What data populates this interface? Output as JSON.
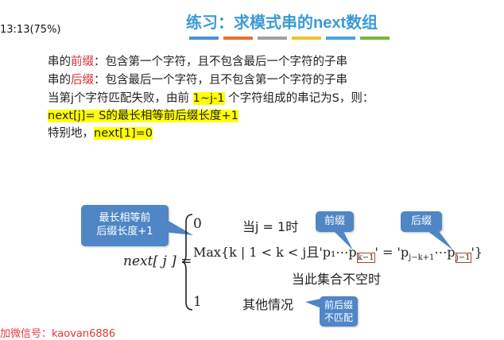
{
  "timestamp": "13:13(75%)",
  "title": {
    "prefix": "练习：求模式串的",
    "code": "next",
    "suffix": "数组"
  },
  "title_bar_colors": [
    "#4a90d9",
    "#e8702a",
    "#a0a0a0",
    "#f2c230",
    "#4aa3df",
    "#7cb342"
  ],
  "text": {
    "prefix_line": {
      "a": "串的",
      "b": "前缀",
      "c": "：包含第一个字符，且不包含最后一个字符的子串"
    },
    "suffix_line": {
      "a": "串的",
      "b": "后缀",
      "c": "：包含最后一个字符，且不包含第一个字符的子串"
    },
    "fail_line": {
      "a": "当第j个字符匹配失败，由前 ",
      "b": "1~j-1",
      "c": " 个字符组成的串记为S，则："
    },
    "def_line": "next[j]= S的最长相等前后缀长度+1",
    "special_line": {
      "a": "特别地，",
      "b": "next[1]=0"
    }
  },
  "callouts": {
    "longest": "最长相等前后缀长度+1",
    "prefix": "前缀",
    "suffix": "后缀",
    "no_match": "前后缀不匹配"
  },
  "formula": {
    "lhs": "next[ j ] =",
    "case1_value": "0",
    "case1_cond": "当j = 1时",
    "case2_text": "Max{k | 1 < k < j且'p₁⋯p",
    "case2_sub1": "k−1",
    "case2_mid": "' = 'p",
    "case2_sub2": "j−k+1",
    "case2_mid2": "⋯p",
    "case2_sub3": "j−1",
    "case2_end": "'}",
    "case2_note": "当此集合不空时",
    "case3_value": "1",
    "case3_cond": "其他情况"
  },
  "watermark": "加微信号：kaovan6886"
}
